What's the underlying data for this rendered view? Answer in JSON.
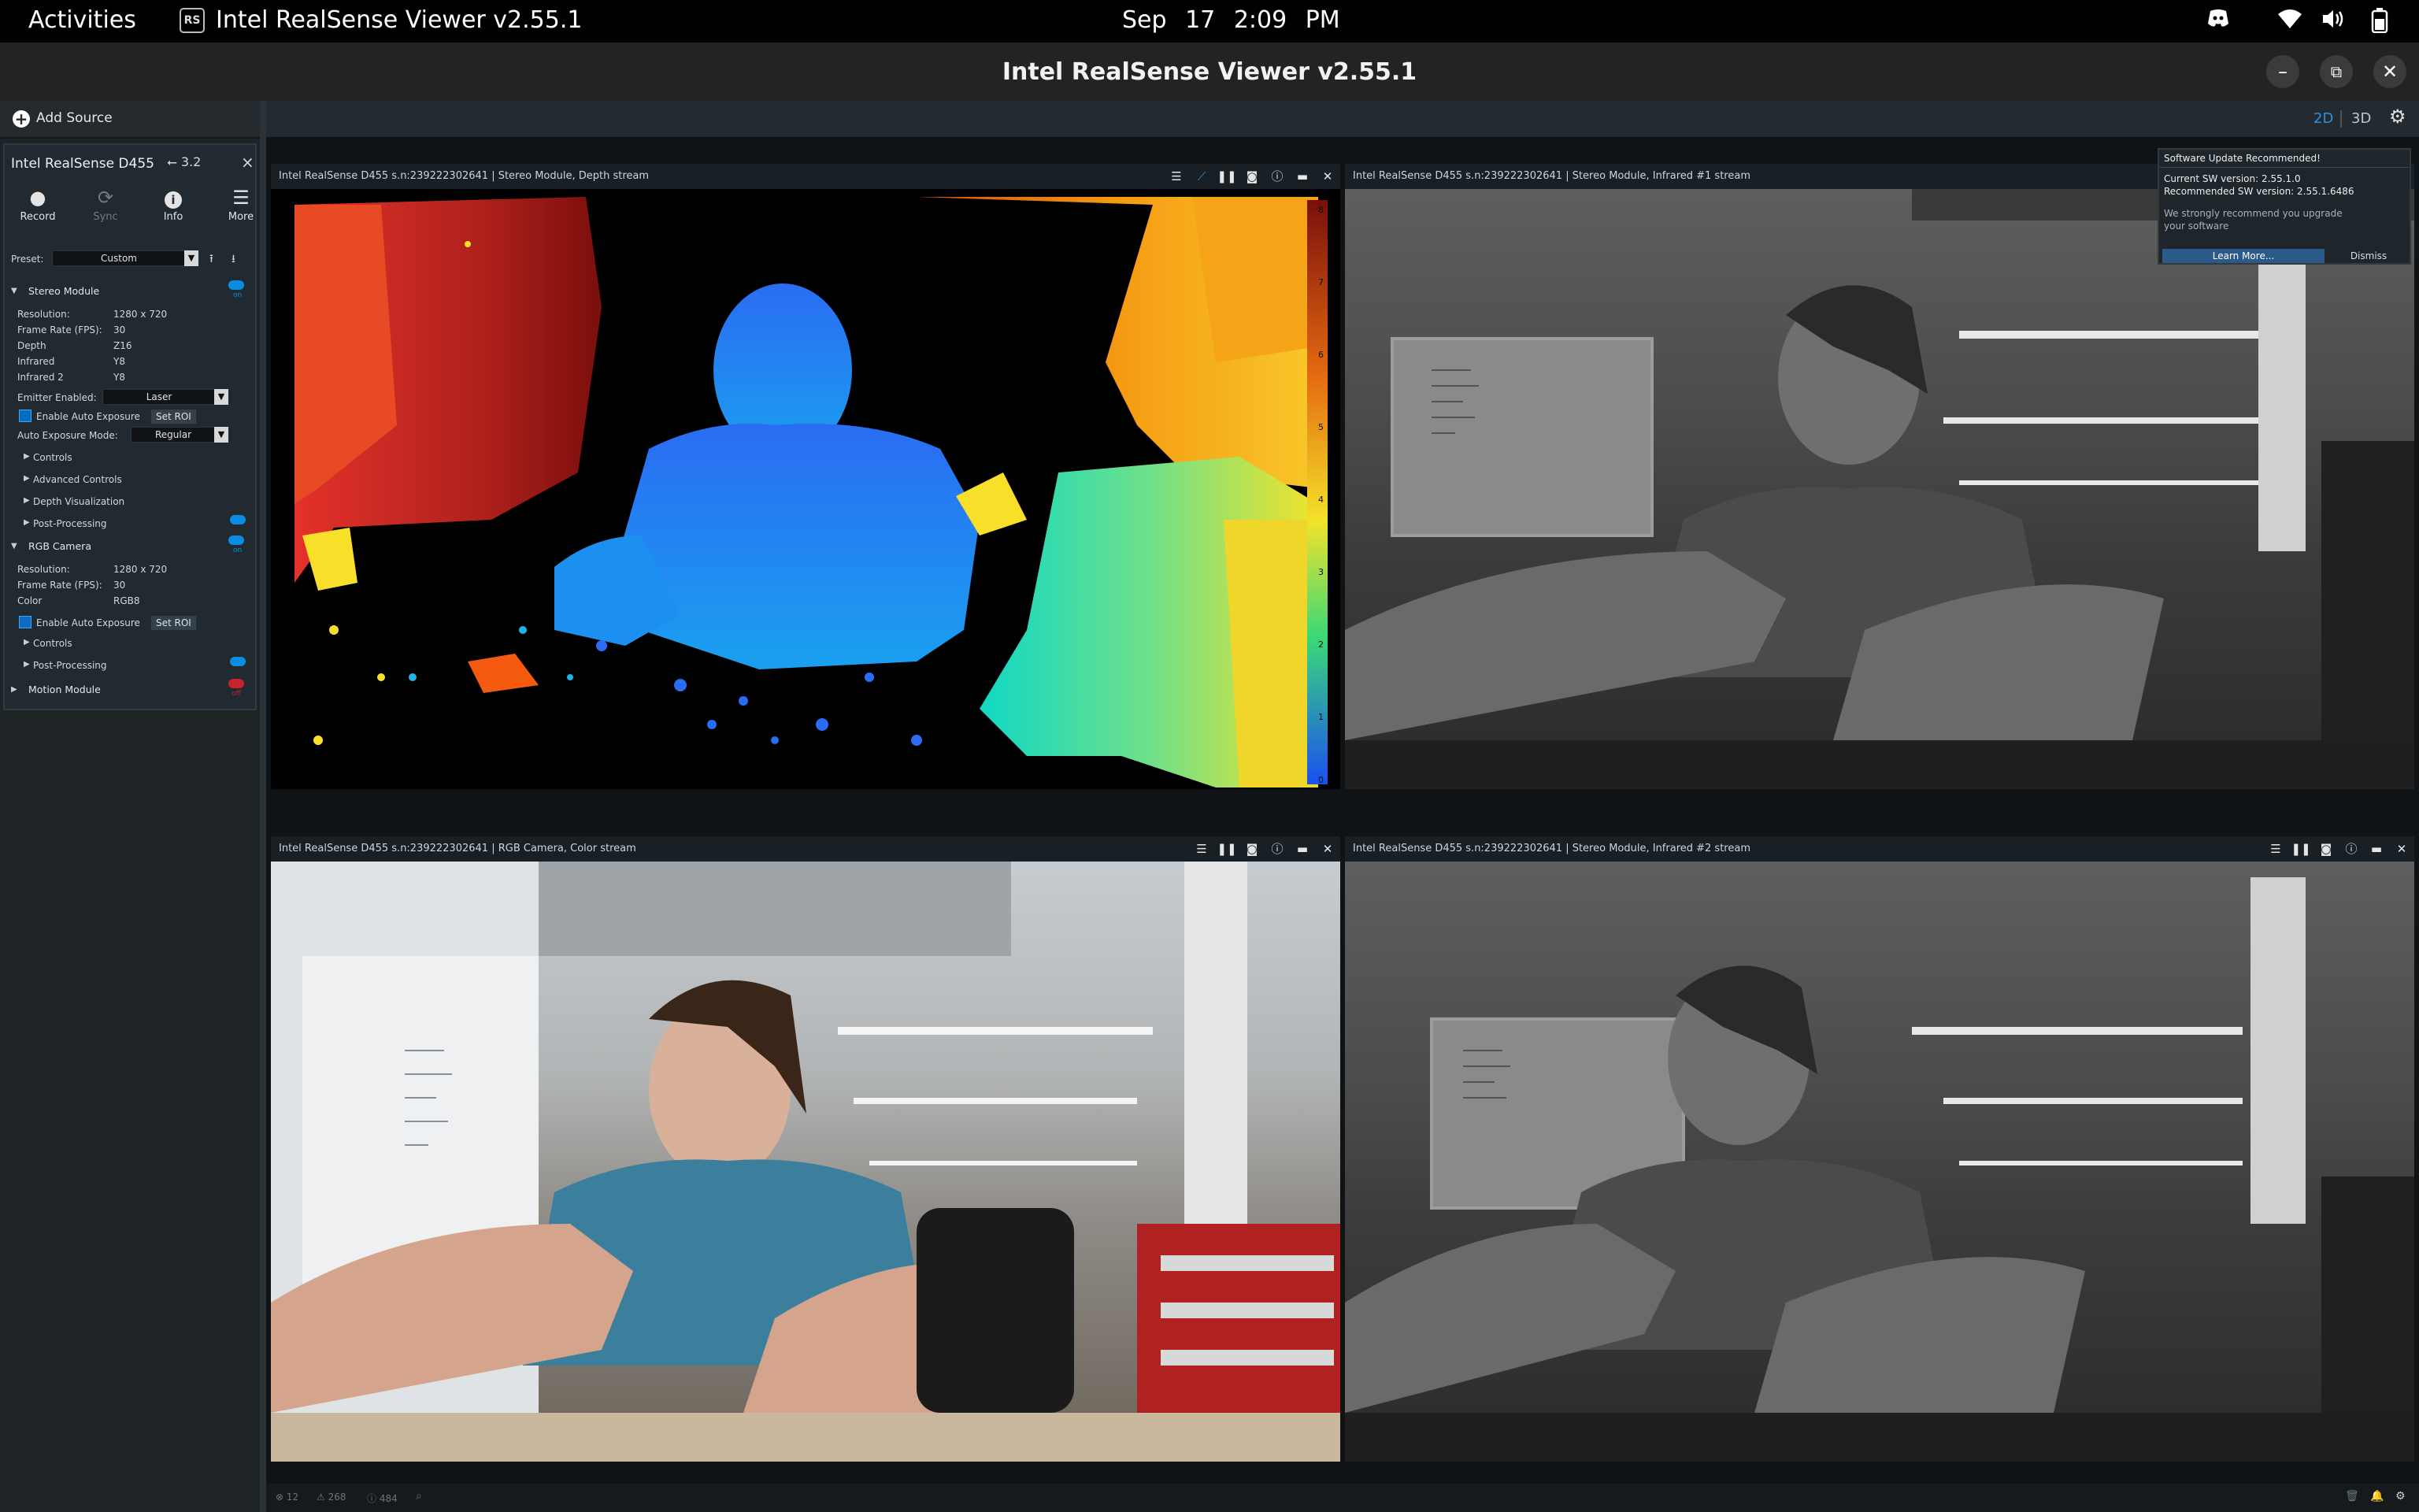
{
  "topbar": {
    "activities": "Activities",
    "app_icon_text": "RS",
    "app_name": "Intel RealSense Viewer v2.55.1",
    "date": "Sep 17",
    "time": "2:09 PM",
    "tray_icons": [
      "discord-icon",
      "wifi-icon",
      "volume-icon",
      "battery-icon"
    ]
  },
  "window": {
    "title": "Intel RealSense Viewer v2.55.1",
    "minimize": "–",
    "maximize": "⧉",
    "close": "✕"
  },
  "sidebar": {
    "add_source": "Add Source",
    "device": {
      "name": "Intel RealSense D455",
      "usb": "3.2",
      "close": "×",
      "tools": [
        {
          "label": "Record",
          "icon": "●"
        },
        {
          "label": "Sync",
          "icon": "⟳"
        },
        {
          "label": "Info",
          "icon": "i"
        },
        {
          "label": "More",
          "icon": "☰"
        }
      ],
      "preset_label": "Preset:",
      "preset_value": "Custom",
      "stereo": {
        "title": "Stereo Module",
        "toggle_label": "on",
        "rows": [
          {
            "k": "Resolution:",
            "v": "1280 x 720"
          },
          {
            "k": "Frame Rate (FPS):",
            "v": "30"
          },
          {
            "k": "Depth",
            "v": "Z16"
          },
          {
            "k": "Infrared",
            "v": "Y8"
          },
          {
            "k": "Infrared 2",
            "v": "Y8"
          }
        ],
        "emitter_label": "Emitter Enabled:",
        "emitter_value": "Laser",
        "auto_exposure": "Enable Auto Exposure",
        "set_roi": "Set ROI",
        "ae_mode_label": "Auto Exposure Mode:",
        "ae_mode_value": "Regular",
        "subsections": [
          "Controls",
          "Advanced Controls",
          "Depth Visualization",
          "Post-Processing"
        ]
      },
      "rgb": {
        "title": "RGB Camera",
        "toggle_label": "on",
        "rows": [
          {
            "k": "Resolution:",
            "v": "1280 x 720"
          },
          {
            "k": "Frame Rate (FPS):",
            "v": "30"
          },
          {
            "k": "Color",
            "v": "RGB8"
          }
        ],
        "auto_exposure": "Enable Auto Exposure",
        "set_roi": "Set ROI",
        "subsections": [
          "Controls",
          "Post-Processing"
        ]
      },
      "motion": {
        "title": "Motion Module",
        "toggle_label": "off"
      }
    }
  },
  "view_modes": {
    "mode_2d": "2D",
    "mode_3d": "3D"
  },
  "streams": {
    "depth": {
      "title": "Intel RealSense D455 s.n:239222302641 | Stereo Module, Depth stream",
      "scale": [
        "8",
        "7",
        "6",
        "5",
        "4",
        "3",
        "2",
        "1",
        "0"
      ]
    },
    "ir1": {
      "title": "Intel RealSense D455 s.n:239222302641 | Stereo Module, Infrared #1 stream"
    },
    "color": {
      "title": "Intel RealSense D455 s.n:239222302641 | RGB Camera, Color stream"
    },
    "ir2": {
      "title": "Intel RealSense D455 s.n:239222302641 | Stereo Module, Infrared #2 stream"
    }
  },
  "update": {
    "title": "Software Update Recommended!",
    "current": "Current SW version: 2.55.1.0",
    "recommended": "Recommended SW version: 2.55.1.6486",
    "message_1": "We strongly recommend you upgrade",
    "message_2": "your software",
    "learn_more": "Learn More...",
    "dismiss": "Dismiss"
  },
  "status": {
    "counts": [
      "12",
      "268",
      "484"
    ]
  }
}
